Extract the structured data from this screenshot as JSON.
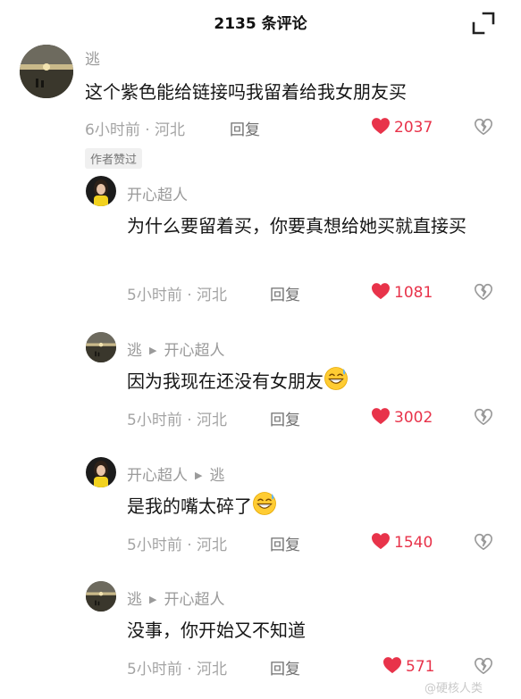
{
  "header": {
    "title": "2135 条评论"
  },
  "comments": [
    {
      "author": "逃",
      "text": "这个紫色能给链接吗我留着给我女朋友买",
      "time": "6小时前 · 河北",
      "reply": "回复",
      "likes": "2037",
      "badge": "作者赞过"
    },
    {
      "author": "开心超人",
      "text": "为什么要留着买，你要真想给她买就直接买",
      "time": "5小时前 · 河北",
      "reply": "回复",
      "likes": "1081"
    },
    {
      "author": "逃",
      "target": "开心超人",
      "text": "因为我现在还没有女朋友",
      "time": "5小时前 · 河北",
      "reply": "回复",
      "likes": "3002"
    },
    {
      "author": "开心超人",
      "target": "逃",
      "text": "是我的嘴太碎了",
      "time": "5小时前 · 河北",
      "reply": "回复",
      "likes": "1540"
    },
    {
      "author": "逃",
      "target": "开心超人",
      "text": "没事，你开始又不知道",
      "time": "5小时前 · 河北",
      "reply": "回复",
      "likes": "571"
    }
  ],
  "watermark": "@硬核人类",
  "colors": {
    "like_red": "#e8334a",
    "meta_gray": "#a4a4a4",
    "name_gray": "#9a9a9a"
  },
  "icons": [
    "collapse-icon",
    "heart-icon",
    "dislike-icon",
    "grin-sweat-emoji"
  ]
}
